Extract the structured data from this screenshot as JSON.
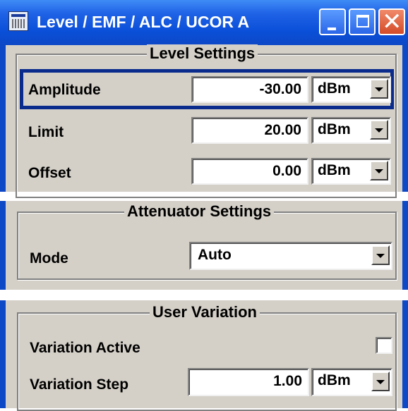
{
  "window": {
    "title": "Level / EMF / ALC / UCOR A"
  },
  "level_settings": {
    "legend": "Level Settings",
    "rows": [
      {
        "label": "Amplitude",
        "value": "-30.00",
        "unit": "dBm"
      },
      {
        "label": "Limit",
        "value": "20.00",
        "unit": "dBm"
      },
      {
        "label": "Offset",
        "value": "0.00",
        "unit": "dBm"
      }
    ]
  },
  "attenuator_settings": {
    "legend": "Attenuator Settings",
    "mode_label": "Mode",
    "mode_value": "Auto"
  },
  "user_variation": {
    "legend": "User Variation",
    "active_label": "Variation Active",
    "active_checked": false,
    "step_label": "Variation Step",
    "step_value": "1.00",
    "step_unit": "dBm"
  }
}
